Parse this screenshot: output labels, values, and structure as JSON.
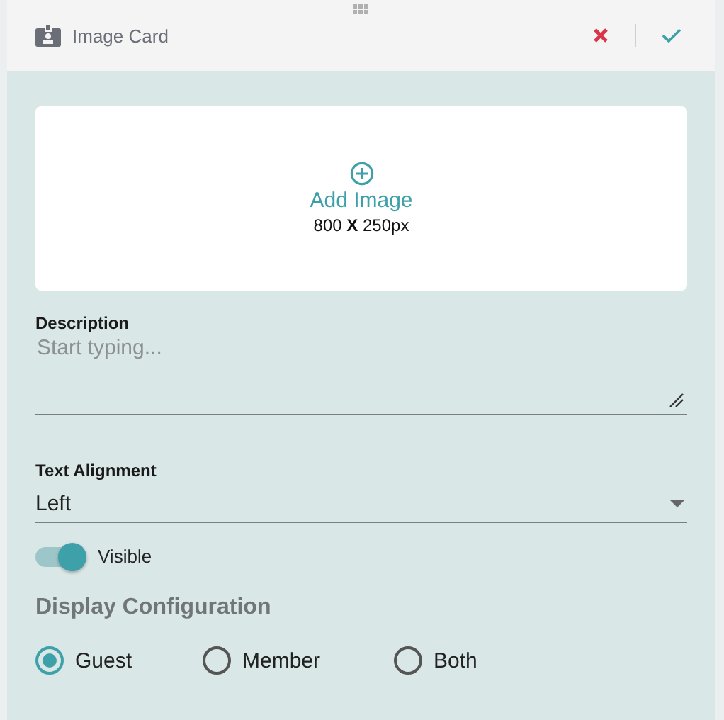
{
  "header": {
    "title": "Image Card"
  },
  "image_upload": {
    "label": "Add Image",
    "dimensions": "800 **X** 250px"
  },
  "description": {
    "label": "Description",
    "placeholder": "Start typing..."
  },
  "text_alignment": {
    "label": "Text Alignment",
    "value": "Left"
  },
  "visible": {
    "label": "Visible",
    "on": true
  },
  "display_configuration": {
    "title": "Display Configuration",
    "options": [
      {
        "label": "Guest",
        "selected": true
      },
      {
        "label": "Member",
        "selected": false
      },
      {
        "label": "Both",
        "selected": false
      }
    ]
  }
}
